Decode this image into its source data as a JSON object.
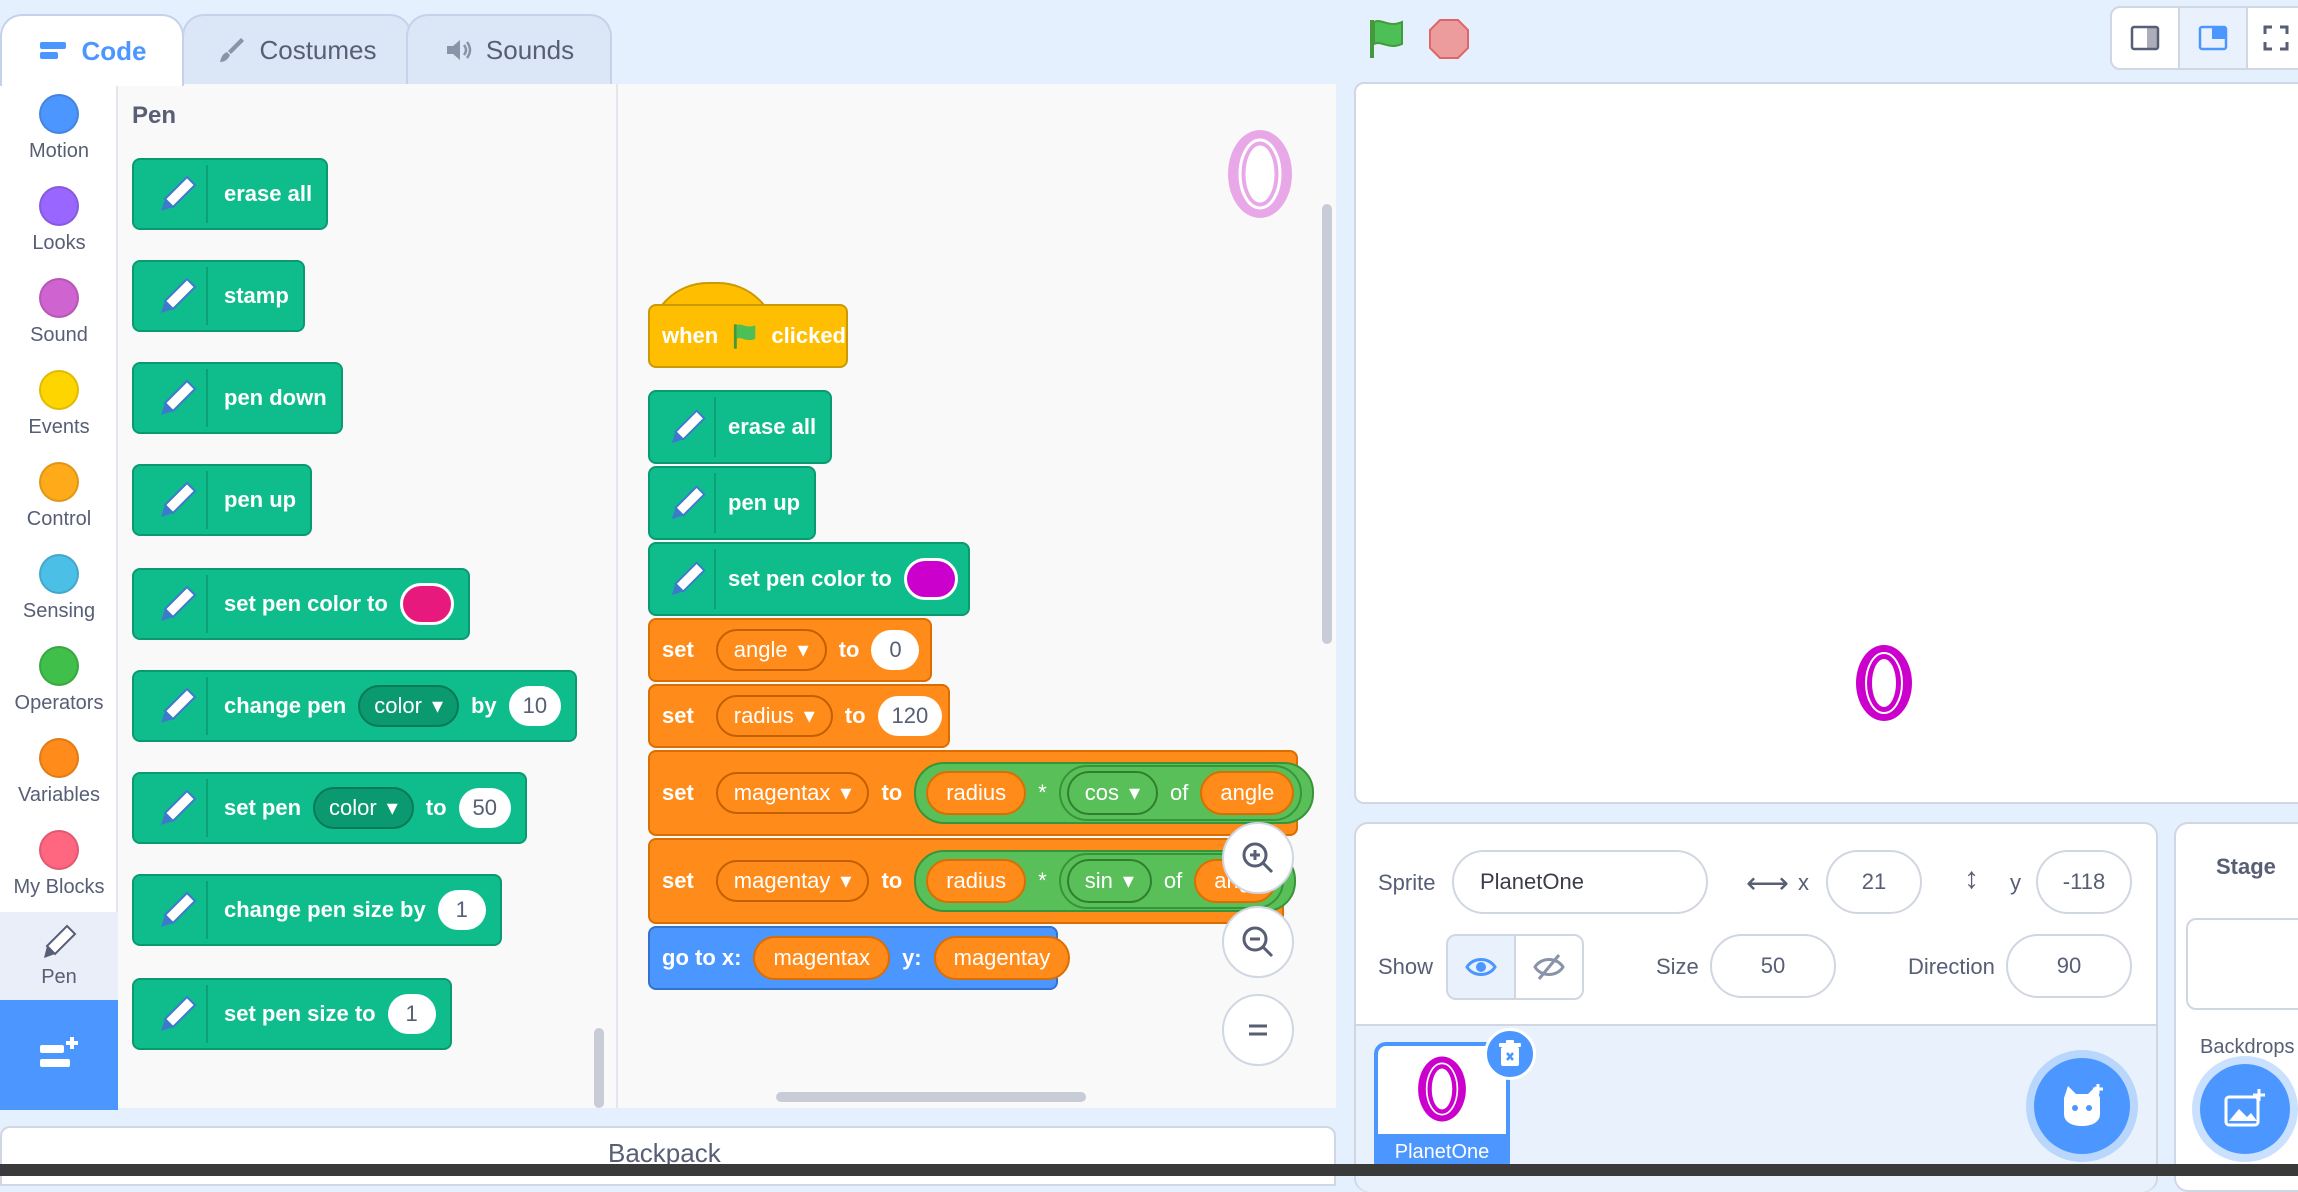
{
  "tabs": {
    "code": "Code",
    "costumes": "Costumes",
    "sounds": "Sounds"
  },
  "categories": [
    {
      "label": "Motion",
      "color": "#4c97ff"
    },
    {
      "label": "Looks",
      "color": "#9966ff"
    },
    {
      "label": "Sound",
      "color": "#cf63cf"
    },
    {
      "label": "Events",
      "color": "#ffd500"
    },
    {
      "label": "Control",
      "color": "#ffab19"
    },
    {
      "label": "Sensing",
      "color": "#4cbfe6"
    },
    {
      "label": "Operators",
      "color": "#40bf4a"
    },
    {
      "label": "Variables",
      "color": "#ff8c1a"
    },
    {
      "label": "My Blocks",
      "color": "#ff6680"
    },
    {
      "label": "Pen",
      "color": "#0fbd8c"
    }
  ],
  "palette": {
    "title": "Pen",
    "erase_all": "erase all",
    "stamp": "stamp",
    "pen_down": "pen down",
    "pen_up": "pen up",
    "set_pen_color": "set pen color to",
    "change_pen": "change pen",
    "change_pen_dd": "color",
    "change_pen_by": "by",
    "change_pen_val": "10",
    "set_pen": "set pen",
    "set_pen_dd": "color",
    "set_pen_to": "to",
    "set_pen_val": "50",
    "change_size": "change pen size by",
    "change_size_val": "1",
    "set_size": "set pen size to",
    "set_size_val": "1",
    "pen_color_swatch": "#e8197d"
  },
  "script": {
    "when": "when",
    "clicked": "clicked",
    "erase_all": "erase all",
    "pen_up": "pen up",
    "set_pen_color": "set pen color to",
    "pen_color_swatch": "#cc00cc",
    "set": "set",
    "to": "to",
    "of": "of",
    "times": "*",
    "var_angle": "angle",
    "val_angle": "0",
    "var_radius": "radius",
    "val_radius": "120",
    "var_magentax": "magentax",
    "var_magentay": "magentay",
    "fn_cos": "cos",
    "fn_sin": "sin",
    "goto_x": "go to x:",
    "goto_y": "y:",
    "angle_clip": "angl"
  },
  "backpack": "Backpack",
  "sprite": {
    "label": "Sprite",
    "name": "PlanetOne",
    "x_label": "x",
    "x": "21",
    "y_label": "y",
    "y": "-118",
    "show_label": "Show",
    "size_label": "Size",
    "size": "50",
    "direction_label": "Direction",
    "direction": "90",
    "thumb_name": "PlanetOne"
  },
  "stage_panel": {
    "title": "Stage",
    "backdrops": "Backdrops"
  },
  "sprite_glyph": "0"
}
